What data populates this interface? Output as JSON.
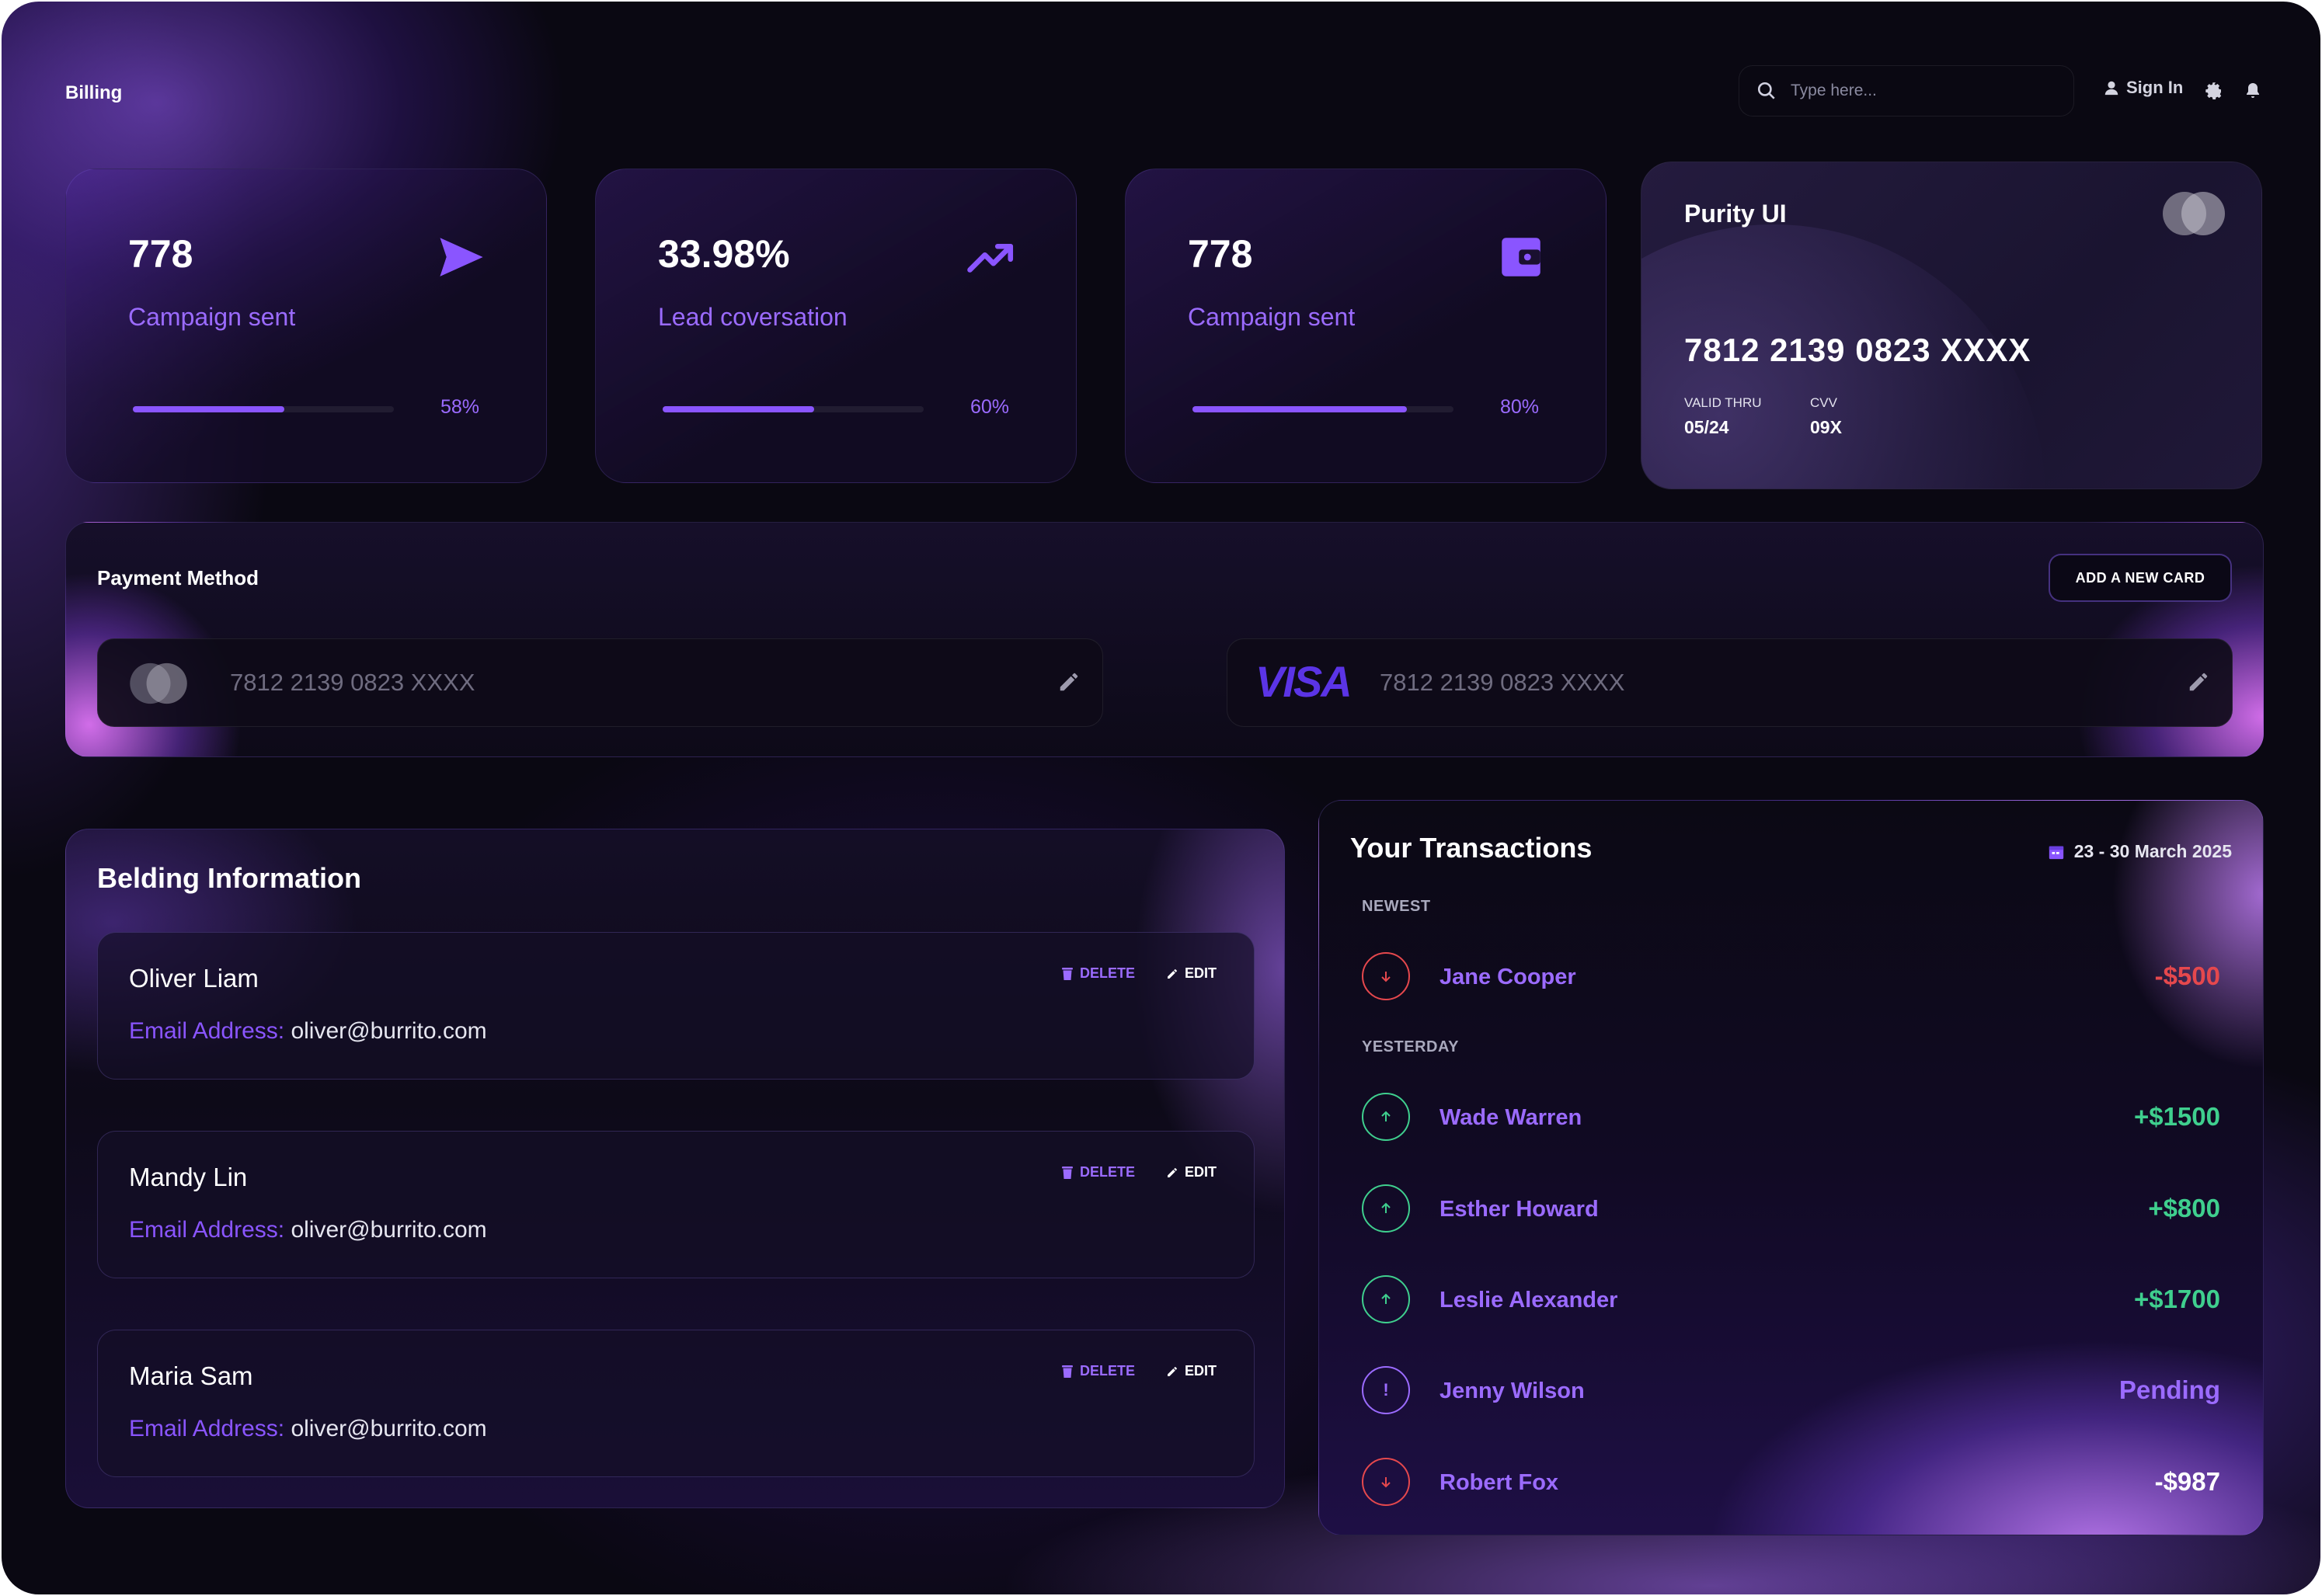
{
  "header": {
    "title": "Billing",
    "search_placeholder": "Type here...",
    "sign_in_label": "Sign In"
  },
  "stats": [
    {
      "value": "778",
      "label": "Campaign sent",
      "percent": "58%",
      "progress": 0.58,
      "icon": "send-icon"
    },
    {
      "value": "33.98%",
      "label": "Lead coversation",
      "percent": "60%",
      "progress": 0.6,
      "icon": "trending-up-icon"
    },
    {
      "value": "778",
      "label": "Campaign sent",
      "percent": "80%",
      "progress": 0.8,
      "icon": "wallet-icon"
    }
  ],
  "credit_card": {
    "brand": "Purity UI",
    "number": "7812 2139 0823 XXXX",
    "valid_thru_label": "VALID THRU",
    "valid_thru": "05/24",
    "cvv_label": "CVV",
    "cvv": "09X"
  },
  "payment_method": {
    "title": "Payment Method",
    "add_button": "ADD A NEW CARD",
    "cards": [
      {
        "brand_icon": "mastercard-icon",
        "number": "7812 2139 0823 XXXX"
      },
      {
        "brand_text": "VISA",
        "number": "7812 2139 0823 XXXX"
      }
    ]
  },
  "billing": {
    "title": "Belding Information",
    "email_label": "Email Address:",
    "delete_label": "DELETE",
    "edit_label": "EDIT",
    "items": [
      {
        "name": "Oliver Liam",
        "email": "oliver@burrito.com"
      },
      {
        "name": "Mandy Lin",
        "email": "oliver@burrito.com"
      },
      {
        "name": "Maria Sam",
        "email": "oliver@burrito.com"
      }
    ]
  },
  "transactions": {
    "title": "Your Transactions",
    "date_range": "23 - 30 March 2025",
    "sections": {
      "newest": "NEWEST",
      "yesterday": "YESTERDAY"
    },
    "items": [
      {
        "name": "Jane Cooper",
        "amount": "-$500",
        "direction": "down"
      },
      {
        "name": "Wade Warren",
        "amount": "+$1500",
        "direction": "up"
      },
      {
        "name": "Esther Howard",
        "amount": "+$800",
        "direction": "up"
      },
      {
        "name": "Leslie Alexander",
        "amount": "+$1700",
        "direction": "up"
      },
      {
        "name": "Jenny Wilson",
        "amount": "Pending",
        "direction": "pending"
      },
      {
        "name": "Robert Fox",
        "amount": "-$987",
        "direction": "down"
      }
    ]
  },
  "colors": {
    "accent": "#8a55ff",
    "positive": "#3fcf8e",
    "negative": "#e5484d",
    "pending": "#9b6bff"
  }
}
